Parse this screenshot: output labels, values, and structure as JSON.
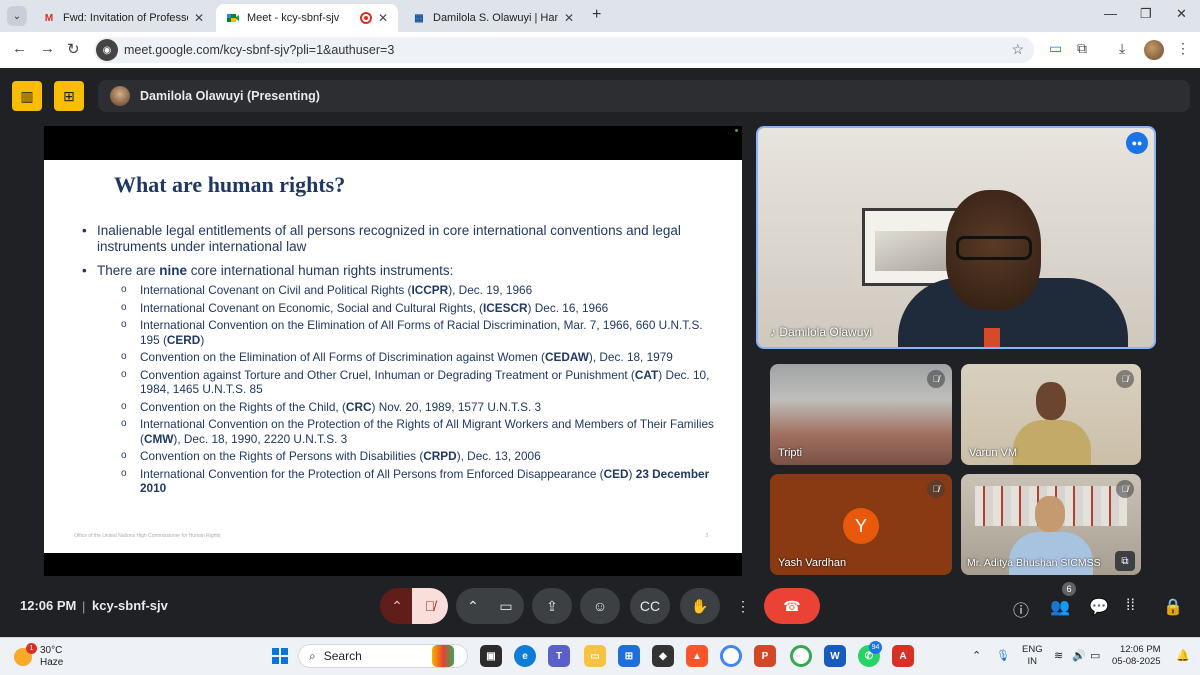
{
  "browser": {
    "tabs": [
      {
        "title": "Fwd: Invitation of Professor Ola",
        "favicon": "gmail-icon",
        "active": false
      },
      {
        "title": "Meet - kcy-sbnf-sjv",
        "favicon": "meet-icon",
        "active": true
      },
      {
        "title": "Damilola S. Olawuyi | Hamad Bi",
        "favicon": "website-icon",
        "active": false
      }
    ],
    "url": "meet.google.com/kcy-sbnf-sjv?pli=1&authuser=3"
  },
  "meet": {
    "presenter_label": "Damilola Olawuyi (Presenting)",
    "time": "12:06 PM",
    "meeting_code": "kcy-sbnf-sjv",
    "participant_count": "6",
    "participants": [
      {
        "name": "Damilola Olawuyi",
        "speaking": true
      },
      {
        "name": "Tripti",
        "muted": true
      },
      {
        "name": "Varun VM",
        "muted": true
      },
      {
        "name": "Yash Vardhan",
        "initial": "Y",
        "muted": true
      },
      {
        "name": "Mr. Aditya Bhushan SICMSS",
        "muted": true
      }
    ],
    "colors": {
      "end_call": "#ea4335",
      "speaker_border": "#8ab4f8",
      "presenting_button": "#fbbc04",
      "avatar_y": "#e8590c"
    }
  },
  "slide": {
    "title": "What are human rights?",
    "bullet1": "Inalienable legal entitlements of all persons recognized in core international conventions and legal instruments under international law",
    "bullet2_pre": "There are ",
    "bullet2_bold": "nine",
    "bullet2_post": " core international human rights instruments:",
    "instruments": [
      {
        "pre": "International Covenant on Civil and Political Rights (",
        "bold": "ICCPR",
        "post": "), Dec. 19, 1966"
      },
      {
        "pre": "International Covenant on Economic, Social and Cultural Rights, (",
        "bold": "ICESCR",
        "post": ") Dec. 16, 1966"
      },
      {
        "pre": "International Convention on the Elimination of All Forms of Racial Discrimination, Mar. 7, 1966, 660 U.N.T.S. 195 (",
        "bold": "CERD",
        "post": ")"
      },
      {
        "pre": "Convention on the Elimination of All Forms of Discrimination against Women (",
        "bold": "CEDAW",
        "post": "), Dec. 18, 1979"
      },
      {
        "pre": "Convention against Torture and Other Cruel, Inhuman or Degrading Treatment or Punishment (",
        "bold": "CAT",
        "post": ") Dec. 10, 1984, 1465 U.N.T.S. 85"
      },
      {
        "pre": "Convention on the Rights of the Child, (",
        "bold": "CRC",
        "post": ") Nov. 20, 1989, 1577 U.N.T.S. 3"
      },
      {
        "pre": "International Convention on the Protection of the Rights of All Migrant Workers and Members of Their Families (",
        "bold": "CMW",
        "post": "), Dec. 18, 1990, 2220 U.N.T.S. 3"
      },
      {
        "pre": "Convention on the Rights of Persons with Disabilities (",
        "bold": "CRPD",
        "post": "), Dec. 13, 2006"
      },
      {
        "pre": "International Convention for the Protection of All Persons from Enforced Disappearance (",
        "bold": "CED",
        "post": ") ",
        "bold2": "23 December 2010"
      }
    ],
    "footer": "Office of the United Nations High Commissioner for Human Rights",
    "page_number": "3"
  },
  "taskbar": {
    "temperature": "30°C",
    "condition": "Haze",
    "weather_badge": "1",
    "search_label": "Search",
    "teams_badge": "94",
    "lang_line1": "ENG",
    "lang_line2": "IN",
    "time": "12:06 PM",
    "date": "05-08-2025"
  }
}
